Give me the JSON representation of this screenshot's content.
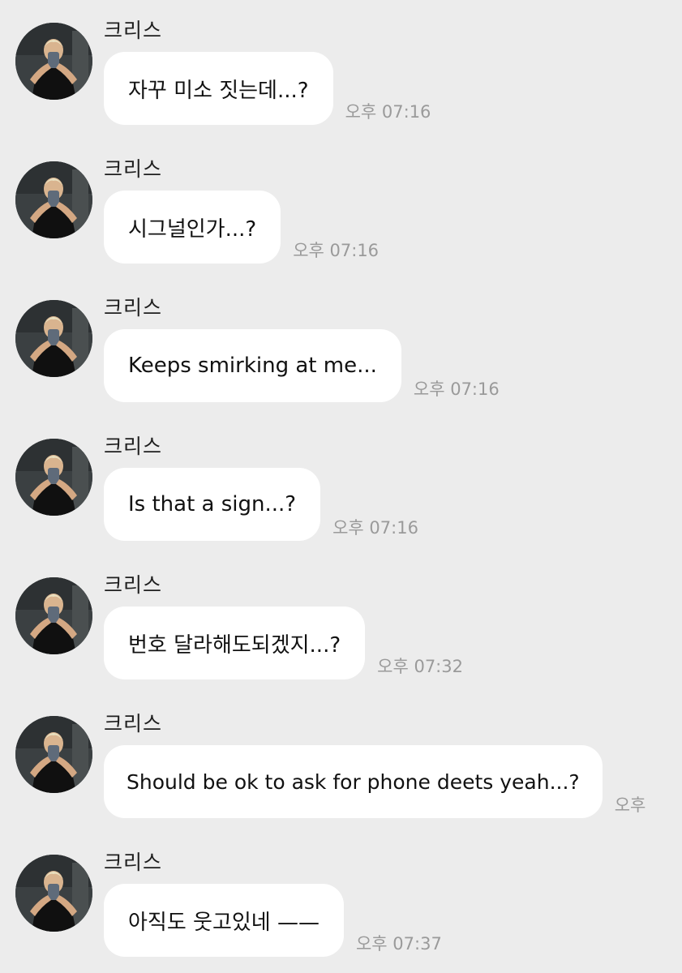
{
  "messages": [
    {
      "sender": "크리스",
      "text": "자꾸 미소 짓는데...?",
      "time": "오후 07:16"
    },
    {
      "sender": "크리스",
      "text": "시그널인가...?",
      "time": "오후 07:16"
    },
    {
      "sender": "크리스",
      "text": "Keeps smirking at me...",
      "time": "오후 07:16"
    },
    {
      "sender": "크리스",
      "text": "Is that a sign...?",
      "time": "오후 07:16"
    },
    {
      "sender": "크리스",
      "text": "번호 달라해도되겠지...?",
      "time": "오후 07:32"
    },
    {
      "sender": "크리스",
      "text": "Should be ok to ask for phone deets yeah...?",
      "time": "오후"
    },
    {
      "sender": "크리스",
      "text": "아직도 웃고있네 ——",
      "time": "오후 07:37"
    }
  ]
}
